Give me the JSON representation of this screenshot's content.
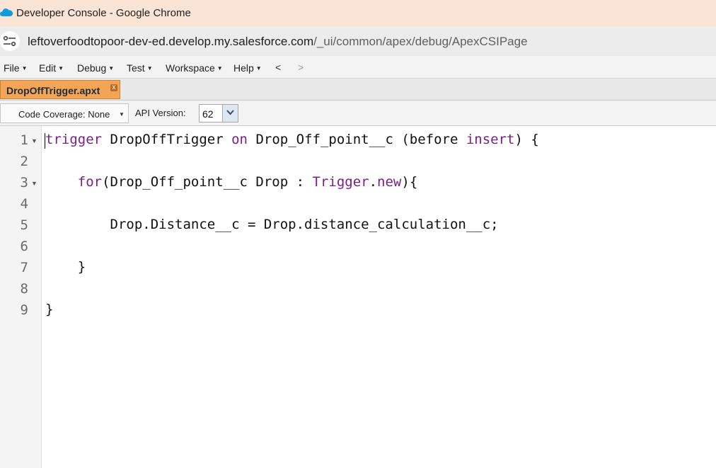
{
  "window": {
    "title": "Developer Console - Google Chrome"
  },
  "address_bar": {
    "domain": "leftoverfoodtopoor-dev-ed.develop.my.salesforce.com",
    "path": "/_ui/common/apex/debug/ApexCSIPage"
  },
  "menu": {
    "items": [
      {
        "label": "File"
      },
      {
        "label": "Edit"
      },
      {
        "label": "Debug"
      },
      {
        "label": "Test"
      },
      {
        "label": "Workspace"
      },
      {
        "label": "Help"
      }
    ],
    "back": "<",
    "forward": ">"
  },
  "tabs": [
    {
      "label": "DropOffTrigger.apxt",
      "close": "x"
    }
  ],
  "toolbar": {
    "code_coverage": "Code Coverage: None",
    "api_version_label": "API Version:",
    "api_version_value": "62"
  },
  "editor": {
    "line_numbers": [
      "1",
      "2",
      "3",
      "4",
      "5",
      "6",
      "7",
      "8",
      "9"
    ],
    "lines": [
      [
        {
          "t": "trigger",
          "k": 1
        },
        {
          "t": " DropOffTrigger ",
          "k": 0
        },
        {
          "t": "on",
          "k": 1
        },
        {
          "t": " Drop_Off_point__c (before ",
          "k": 0
        },
        {
          "t": "insert",
          "k": 1
        },
        {
          "t": ") {",
          "k": 0
        }
      ],
      [],
      [
        {
          "t": "    ",
          "k": 0
        },
        {
          "t": "for",
          "k": 1
        },
        {
          "t": "(Drop_Off_point__c Drop : ",
          "k": 0
        },
        {
          "t": "Trigger",
          "k": 1
        },
        {
          "t": ".",
          "k": 0
        },
        {
          "t": "new",
          "k": 1
        },
        {
          "t": "){",
          "k": 0
        }
      ],
      [],
      [
        {
          "t": "        Drop.Distance__c = Drop.distance_calculation__c;",
          "k": 0
        }
      ],
      [],
      [
        {
          "t": "    }",
          "k": 0
        }
      ],
      [],
      [
        {
          "t": "}",
          "k": 0
        }
      ]
    ]
  },
  "colors": {
    "keyword": "#7a1d87",
    "titlebar": "#fae4d6",
    "active_tab": "#f3a555"
  }
}
